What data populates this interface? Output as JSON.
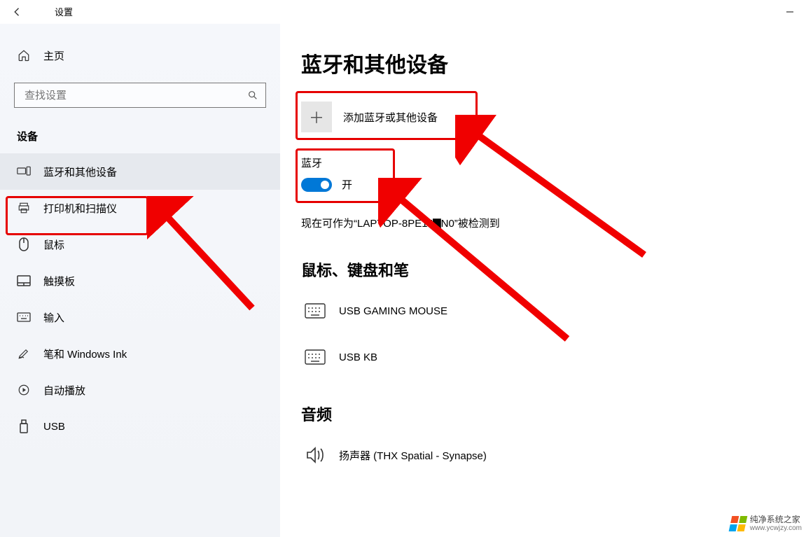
{
  "window": {
    "title": "设置"
  },
  "sidebar": {
    "home": "主页",
    "search_placeholder": "查找设置",
    "section": "设备",
    "items": [
      {
        "label": "蓝牙和其他设备"
      },
      {
        "label": "打印机和扫描仪"
      },
      {
        "label": "鼠标"
      },
      {
        "label": "触摸板"
      },
      {
        "label": "输入"
      },
      {
        "label": "笔和 Windows Ink"
      },
      {
        "label": "自动播放"
      },
      {
        "label": "USB"
      }
    ]
  },
  "main": {
    "title": "蓝牙和其他设备",
    "add_device": "添加蓝牙或其他设备",
    "bt_label": "蓝牙",
    "bt_state": "开",
    "status": "现在可作为“LAPTOP-8PE1J▇N0”被检测到",
    "group1": "鼠标、键盘和笔",
    "devices": [
      {
        "name": "USB GAMING MOUSE"
      },
      {
        "name": "USB KB"
      }
    ],
    "group2": "音频",
    "audio": [
      {
        "name": "扬声器 (THX Spatial - Synapse)"
      }
    ]
  },
  "watermark": {
    "line1": "纯净系统之家",
    "line2": "www.ycwjzy.com"
  }
}
